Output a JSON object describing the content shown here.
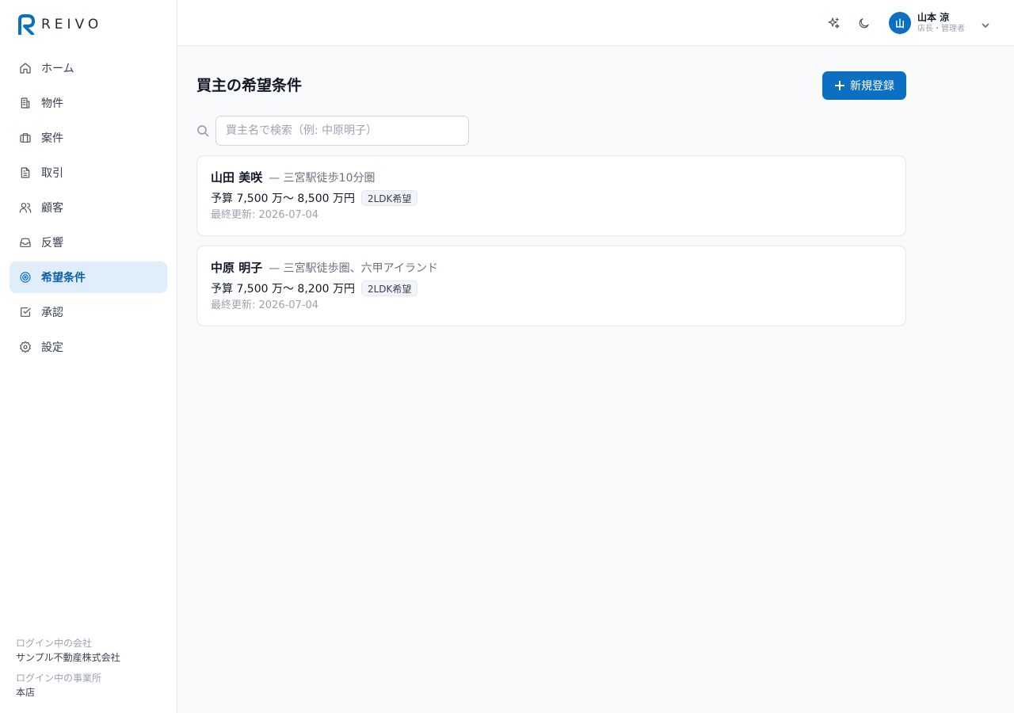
{
  "app": {
    "logo_text": "REIVO"
  },
  "sidebar": {
    "items": [
      {
        "label": "ホーム",
        "icon": "home-icon"
      },
      {
        "label": "物件",
        "icon": "building-icon"
      },
      {
        "label": "案件",
        "icon": "briefcase-icon"
      },
      {
        "label": "取引",
        "icon": "document-icon"
      },
      {
        "label": "顧客",
        "icon": "users-icon"
      },
      {
        "label": "反響",
        "icon": "inbox-icon"
      },
      {
        "label": "希望条件",
        "icon": "target-icon",
        "active": true
      },
      {
        "label": "承認",
        "icon": "check-square-icon"
      },
      {
        "label": "設定",
        "icon": "gear-icon"
      }
    ],
    "footer": {
      "company_label": "ログイン中の会社",
      "company_value": "サンプル不動産株式会社",
      "office_label": "ログイン中の事業所",
      "office_value": "本店"
    }
  },
  "header": {
    "user": {
      "avatar_initial": "山",
      "name": "山本 涼",
      "role": "店長・管理者"
    }
  },
  "main": {
    "title": "買主の希望条件",
    "new_button_label": "新規登録",
    "search": {
      "placeholder": "買主名で検索（例: 中原明子）",
      "value": ""
    },
    "cards": [
      {
        "name": "山田 美咲",
        "area": "— 三宮駅徒歩10分圏",
        "budget": "予算 7,500 万〜 8,500 万円",
        "badge": "2LDK希望",
        "updated": "最終更新: 2026-07-04"
      },
      {
        "name": "中原 明子",
        "area": "— 三宮駅徒歩圏、六甲アイランド",
        "budget": "予算 7,500 万〜 8,200 万円",
        "badge": "2LDK希望",
        "updated": "最終更新: 2026-07-04"
      }
    ]
  },
  "colors": {
    "accent": "#0b6fc2",
    "active_bg": "#e0eefb",
    "page_bg": "#f8fafc"
  }
}
